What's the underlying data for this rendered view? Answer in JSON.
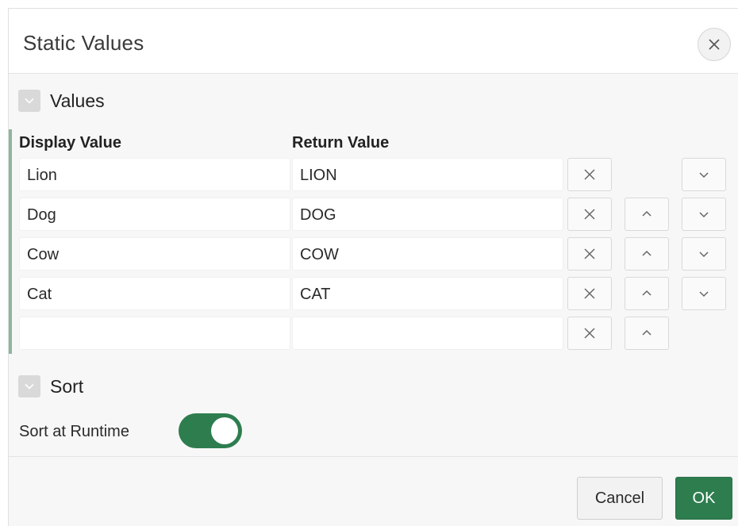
{
  "dialog": {
    "title": "Static Values",
    "close_icon": "close-icon"
  },
  "values_region": {
    "title": "Values",
    "toggle_icon": "chevron-down-icon",
    "columns": {
      "display": "Display Value",
      "return": "Return Value"
    },
    "rows": [
      {
        "display": "Lion",
        "return": "LION"
      },
      {
        "display": "Dog",
        "return": "DOG"
      },
      {
        "display": "Cow",
        "return": "COW"
      },
      {
        "display": "Cat",
        "return": "CAT"
      },
      {
        "display": "",
        "return": ""
      }
    ],
    "row_icons": {
      "delete": "close-icon",
      "move_up": "chevron-up-icon",
      "move_down": "chevron-down-icon"
    }
  },
  "sort_region": {
    "title": "Sort",
    "toggle_icon": "chevron-down-icon",
    "sort_at_runtime_label": "Sort at Runtime",
    "sort_at_runtime_on": true
  },
  "footer": {
    "cancel_label": "Cancel",
    "ok_label": "OK"
  },
  "colors": {
    "accent": "#2e7d4f",
    "accent_bar": "#8fb59c",
    "panel_bg": "#f7f7f7"
  }
}
